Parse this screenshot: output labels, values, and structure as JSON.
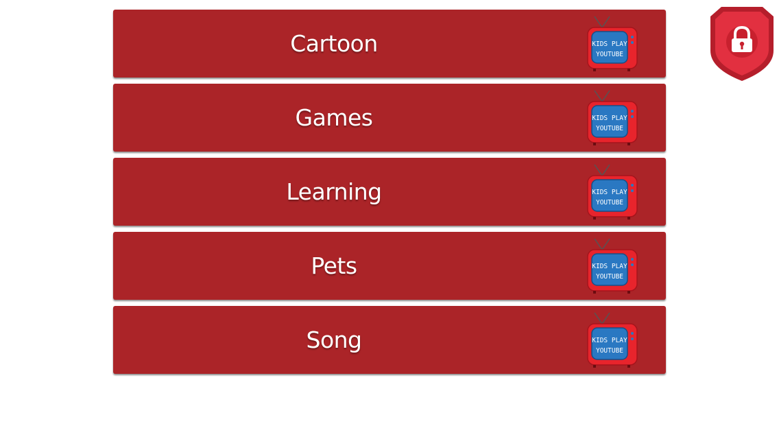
{
  "categories": [
    {
      "label": "Cartoon",
      "icon": "tv-icon",
      "icon_text": [
        "KIDS PLAY",
        "YOUTUBE"
      ]
    },
    {
      "label": "Games",
      "icon": "tv-icon",
      "icon_text": [
        "KIDS PLAY",
        "YOUTUBE"
      ]
    },
    {
      "label": "Learning",
      "icon": "tv-icon",
      "icon_text": [
        "KIDS PLAY",
        "YOUTUBE"
      ]
    },
    {
      "label": "Pets",
      "icon": "tv-icon",
      "icon_text": [
        "KIDS PLAY",
        "YOUTUBE"
      ]
    },
    {
      "label": "Song",
      "icon": "tv-icon",
      "icon_text": [
        "KIDS PLAY",
        "YOUTUBE"
      ]
    }
  ],
  "lock_badge": {
    "icon": "lock-shield-icon"
  },
  "colors": {
    "category_background": "#ab2428",
    "tv_body": "#e8242c",
    "tv_screen": "#2a78c2",
    "badge_outer": "#b51e2b",
    "badge_inner": "#e23040"
  }
}
